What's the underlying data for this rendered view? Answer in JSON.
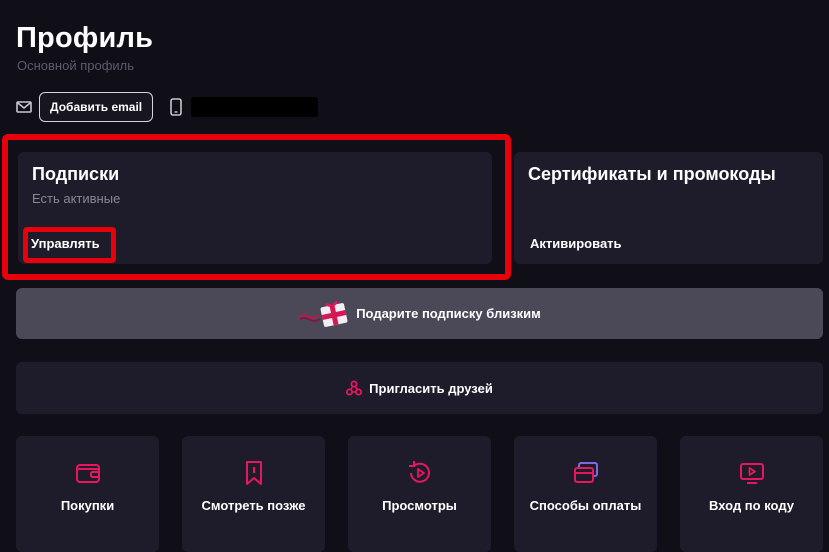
{
  "header": {
    "title": "Профиль",
    "subtitle": "Основной профиль"
  },
  "contacts": {
    "add_email_label": "Добавить email",
    "email_icon": "mail-icon",
    "phone_icon": "phone-icon"
  },
  "cards": {
    "subscriptions": {
      "title": "Подписки",
      "status": "Есть активные",
      "action": "Управлять"
    },
    "certificates": {
      "title": "Сертификаты и промокоды",
      "action": "Активировать"
    }
  },
  "banners": {
    "gift": {
      "label": "Подарите подписку близким",
      "icon": "gift-icon"
    },
    "invite": {
      "label": "Пригласить друзей",
      "icon": "invite-icon"
    }
  },
  "tiles": [
    {
      "label": "Покупки",
      "icon": "wallet-icon"
    },
    {
      "label": "Смотреть позже",
      "icon": "bookmark-icon"
    },
    {
      "label": "Просмотры",
      "icon": "history-icon"
    },
    {
      "label": "Способы оплаты",
      "icon": "cards-icon"
    },
    {
      "label": "Вход по коду",
      "icon": "tv-icon"
    }
  ],
  "colors": {
    "background": "#100e17",
    "card": "#1e1c2a",
    "gift_banner": "#4b4858",
    "accent_pink": "#e6175c",
    "annotation_red": "#e8000b"
  }
}
